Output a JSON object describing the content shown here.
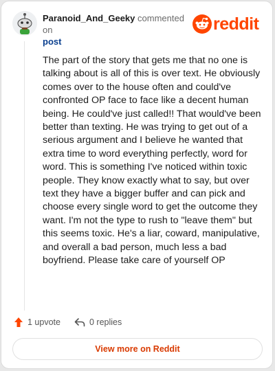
{
  "header": {
    "author": "Paranoid_And_Geeky",
    "verb": "commented on",
    "target": "post",
    "brand": "reddit"
  },
  "comment": {
    "body": "The part of the story that gets me that no one is talking about is all of this is over text. He obviously comes over to the house often and could've confronted OP face to face like a decent human being. He could've just called!! That would've been better than texting. He was trying to get out of a serious argument and I believe he wanted that extra time to word everything perfectly, word for word. This is something I've noticed within toxic people. They know exactly what to say, but over text they have a bigger buffer and can pick and choose every single word to get the outcome they want. I'm not the type to rush to \"leave them\" but this seems toxic. He's a liar, coward, manipulative, and overall a bad person, much less a bad boyfriend. Please take care of yourself OP"
  },
  "actions": {
    "upvotes": "1 upvote",
    "replies": "0 replies"
  },
  "footer": {
    "view_button": "View more on Reddit"
  },
  "icons": {
    "avatar": "snoo-avatar-icon",
    "brand": "reddit-snoo-icon",
    "upvote": "upvote-arrow-icon",
    "reply": "reply-arrow-icon"
  },
  "colors": {
    "brand": "#ff4500",
    "link": "#0a3f8f",
    "button_text": "#d93a00"
  }
}
